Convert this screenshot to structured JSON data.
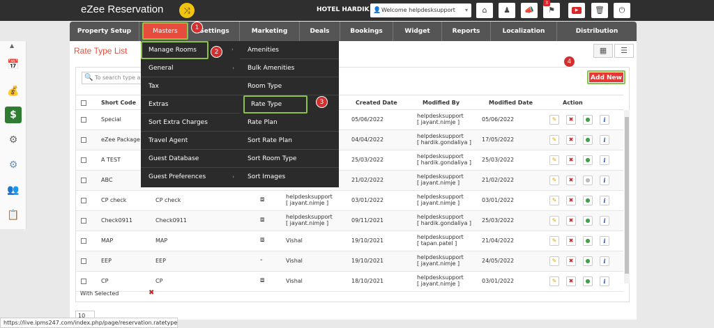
{
  "header": {
    "brand": "eZee Reservation",
    "hotel": "HOTEL HARDIK",
    "welcome": "Welcome helpdesksupport",
    "notif_count": "3"
  },
  "nav": [
    {
      "label": "Property Setup"
    },
    {
      "label": "Masters"
    },
    {
      "label": "Settings"
    },
    {
      "label": "Marketing"
    },
    {
      "label": "Deals"
    },
    {
      "label": "Bookings"
    },
    {
      "label": "Widget"
    },
    {
      "label": "Reports"
    },
    {
      "label": "Localization"
    },
    {
      "label": "Distribution"
    }
  ],
  "page": {
    "title": "Rate Type List",
    "search_placeholder": "To search type a",
    "add_new": "Add New",
    "with_selected": "With Selected",
    "pager": "10"
  },
  "columns": {
    "short_code": "Short Code",
    "created_date": "Created Date",
    "modified_by": "Modified By",
    "modified_date": "Modified Date",
    "action": "Action"
  },
  "rows": [
    {
      "short": "Special",
      "name": "",
      "icon": "",
      "created_by": "",
      "created_user": "",
      "created": "05/06/2022",
      "mod_by": "helpdesksupport",
      "mod_user": "[ jayant.nimje ]",
      "modified": "05/06/2022",
      "active": true
    },
    {
      "short": "eZee Package",
      "name": "",
      "icon": "",
      "created_by": "",
      "created_user": "",
      "created": "04/04/2022",
      "mod_by": "helpdesksupport",
      "mod_user": "[ hardik.gondaliya ]",
      "modified": "17/05/2022",
      "active": true
    },
    {
      "short": "A TEST",
      "name": "",
      "icon": "",
      "created_by": "",
      "created_user": "",
      "created": "25/03/2022",
      "mod_by": "helpdesksupport",
      "mod_user": "[ hardik.gondaliya ]",
      "modified": "25/03/2022",
      "active": true
    },
    {
      "short": "ABC",
      "name": "",
      "icon": "",
      "created_by": "",
      "created_user": "",
      "created": "21/02/2022",
      "mod_by": "helpdesksupport",
      "mod_user": "[ jayant.nimje ]",
      "modified": "21/02/2022",
      "active": false
    },
    {
      "short": "CP check",
      "name": "CP check",
      "icon": "box",
      "created_by": "helpdesksupport",
      "created_user": "[ jayant.nimje ]",
      "created": "03/01/2022",
      "mod_by": "helpdesksupport",
      "mod_user": "[ jayant.nimje ]",
      "modified": "03/01/2022",
      "active": true
    },
    {
      "short": "Check0911",
      "name": "Check0911",
      "icon": "box",
      "created_by": "helpdesksupport",
      "created_user": "[ jayant.nimje ]",
      "created": "09/11/2021",
      "mod_by": "helpdesksupport",
      "mod_user": "[ hardik.gondaliya ]",
      "modified": "25/03/2022",
      "active": true
    },
    {
      "short": "MAP",
      "name": "MAP",
      "icon": "box",
      "created_by": "Vishal",
      "created_user": "",
      "created": "19/10/2021",
      "mod_by": "helpdesksupport",
      "mod_user": "[ tapan.patel ]",
      "modified": "21/04/2022",
      "active": true
    },
    {
      "short": "EEP",
      "name": "EEP",
      "icon": "-",
      "created_by": "Vishal",
      "created_user": "",
      "created": "19/10/2021",
      "mod_by": "helpdesksupport",
      "mod_user": "[ jayant.nimje ]",
      "modified": "24/05/2022",
      "active": true
    },
    {
      "short": "CP",
      "name": "CP",
      "icon": "box",
      "created_by": "Vishal",
      "created_user": "",
      "created": "18/10/2021",
      "mod_by": "helpdesksupport",
      "mod_user": "[ jayant.nimje ]",
      "modified": "03/01/2022",
      "active": true
    }
  ],
  "menu_masters": [
    {
      "label": "Manage Rooms",
      "arrow": true
    },
    {
      "label": "General",
      "arrow": true
    },
    {
      "label": "Tax",
      "arrow": false
    },
    {
      "label": "Extras",
      "arrow": false
    },
    {
      "label": "Sort Extra Charges",
      "arrow": false
    },
    {
      "label": "Travel Agent",
      "arrow": false
    },
    {
      "label": "Guest Database",
      "arrow": false
    },
    {
      "label": "Guest Preferences",
      "arrow": true
    }
  ],
  "menu_rooms": [
    {
      "label": "Amenities"
    },
    {
      "label": "Bulk Amenities"
    },
    {
      "label": "Room Type"
    },
    {
      "label": "Rate Type"
    },
    {
      "label": "Rate Plan"
    },
    {
      "label": "Sort Rate Plan"
    },
    {
      "label": "Sort Room Type"
    },
    {
      "label": "Sort Images"
    }
  ],
  "badges": [
    "1",
    "2",
    "3",
    "4"
  ],
  "status_url": "https://live.ipms247.com/index.php/page/reservation.ratetype"
}
